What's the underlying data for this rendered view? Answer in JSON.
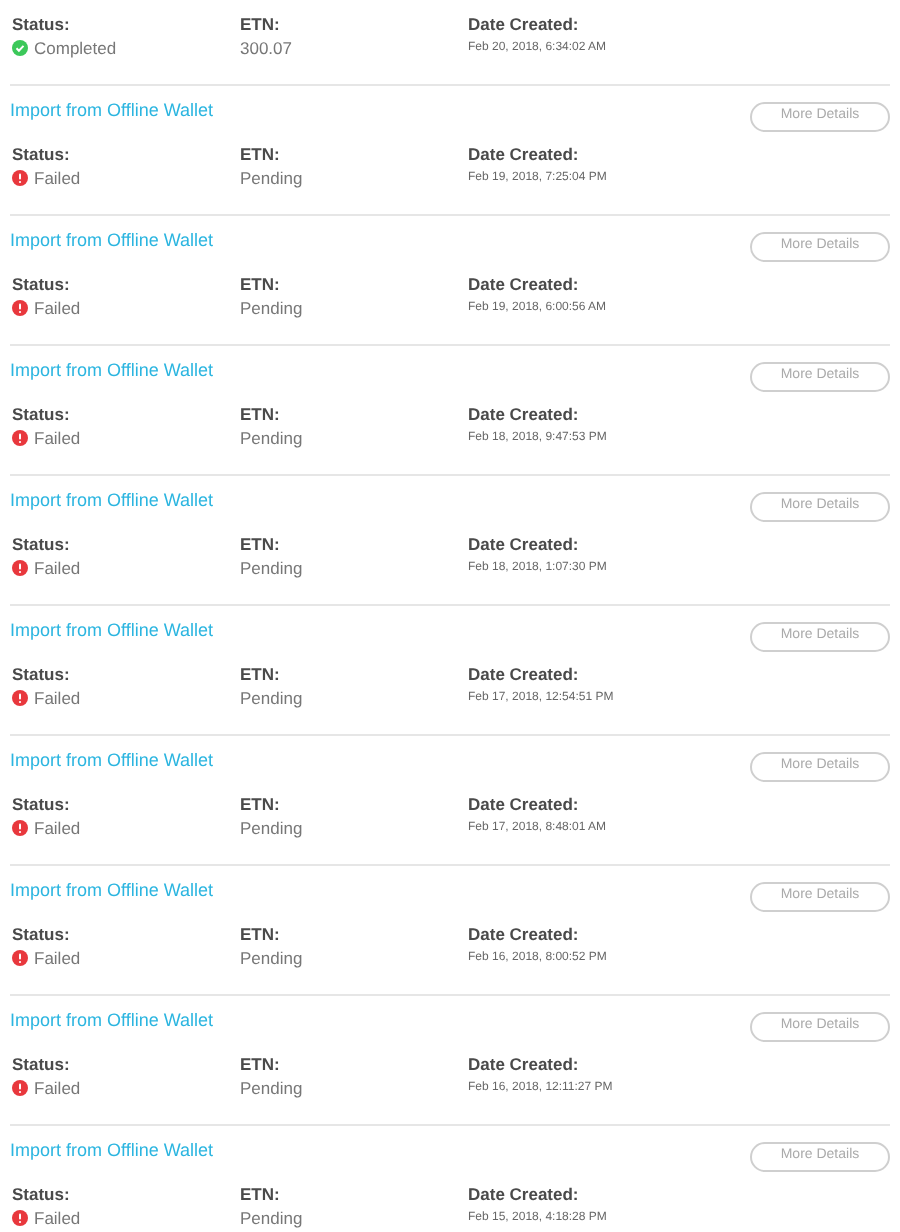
{
  "transactions": [
    {
      "status_label": "Status:",
      "status": {
        "kind": "completed",
        "text": "Completed"
      },
      "etn_label": "ETN:",
      "etn": "300.07",
      "date_label": "Date Created:",
      "date": "Feb 20, 2018, 6:34:02 AM"
    },
    {
      "title": "Import from Offline Wallet",
      "button": "More Details",
      "status_label": "Status:",
      "status": {
        "kind": "failed",
        "text": "Failed"
      },
      "etn_label": "ETN:",
      "etn": "Pending",
      "date_label": "Date Created:",
      "date": "Feb 19, 2018, 7:25:04 PM"
    },
    {
      "title": "Import from Offline Wallet",
      "button": "More Details",
      "status_label": "Status:",
      "status": {
        "kind": "failed",
        "text": "Failed"
      },
      "etn_label": "ETN:",
      "etn": "Pending",
      "date_label": "Date Created:",
      "date": "Feb 19, 2018, 6:00:56 AM"
    },
    {
      "title": "Import from Offline Wallet",
      "button": "More Details",
      "status_label": "Status:",
      "status": {
        "kind": "failed",
        "text": "Failed"
      },
      "etn_label": "ETN:",
      "etn": "Pending",
      "date_label": "Date Created:",
      "date": "Feb 18, 2018, 9:47:53 PM"
    },
    {
      "title": "Import from Offline Wallet",
      "button": "More Details",
      "status_label": "Status:",
      "status": {
        "kind": "failed",
        "text": "Failed"
      },
      "etn_label": "ETN:",
      "etn": "Pending",
      "date_label": "Date Created:",
      "date": "Feb 18, 2018, 1:07:30 PM"
    },
    {
      "title": "Import from Offline Wallet",
      "button": "More Details",
      "status_label": "Status:",
      "status": {
        "kind": "failed",
        "text": "Failed"
      },
      "etn_label": "ETN:",
      "etn": "Pending",
      "date_label": "Date Created:",
      "date": "Feb 17, 2018, 12:54:51 PM"
    },
    {
      "title": "Import from Offline Wallet",
      "button": "More Details",
      "status_label": "Status:",
      "status": {
        "kind": "failed",
        "text": "Failed"
      },
      "etn_label": "ETN:",
      "etn": "Pending",
      "date_label": "Date Created:",
      "date": "Feb 17, 2018, 8:48:01 AM"
    },
    {
      "title": "Import from Offline Wallet",
      "button": "More Details",
      "status_label": "Status:",
      "status": {
        "kind": "failed",
        "text": "Failed"
      },
      "etn_label": "ETN:",
      "etn": "Pending",
      "date_label": "Date Created:",
      "date": "Feb 16, 2018, 8:00:52 PM"
    },
    {
      "title": "Import from Offline Wallet",
      "button": "More Details",
      "status_label": "Status:",
      "status": {
        "kind": "failed",
        "text": "Failed"
      },
      "etn_label": "ETN:",
      "etn": "Pending",
      "date_label": "Date Created:",
      "date": "Feb 16, 2018, 12:11:27 PM"
    },
    {
      "title": "Import from Offline Wallet",
      "button": "More Details",
      "status_label": "Status:",
      "status": {
        "kind": "failed",
        "text": "Failed"
      },
      "etn_label": "ETN:",
      "etn": "Pending",
      "date_label": "Date Created:",
      "date": "Feb 15, 2018, 4:18:28 PM"
    }
  ]
}
